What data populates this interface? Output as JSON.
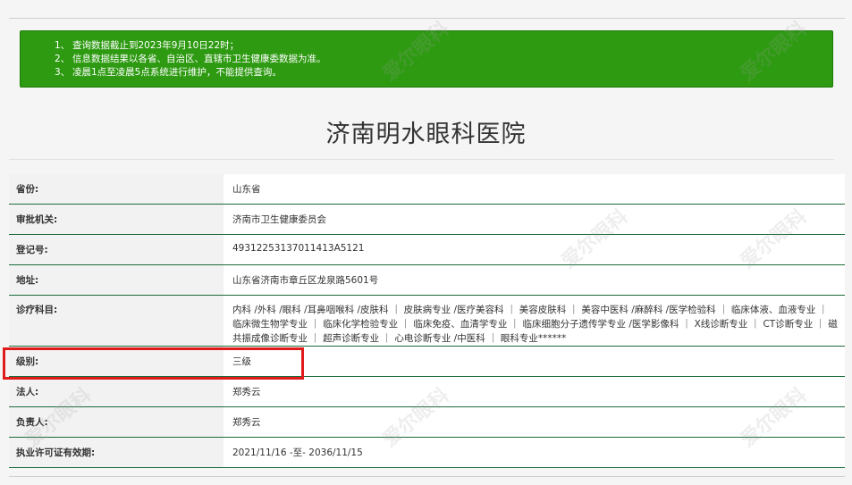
{
  "notice": {
    "items": [
      {
        "num": "1、",
        "text": "查询数据截止到2023年9月10日22时；"
      },
      {
        "num": "2、",
        "text": "信息数据结果以各省、自治区、直辖市卫生健康委数据为准。"
      },
      {
        "num": "3、",
        "text": "凌晨1点至凌晨5点系统进行维护，不能提供查询。"
      }
    ],
    "bg_color": "#2e9a12"
  },
  "hospital_name": "济南明水眼科医院",
  "rows": [
    {
      "key": "省份:",
      "value": "山东省"
    },
    {
      "key": "审批机关:",
      "value": "济南市卫生健康委员会"
    },
    {
      "key": "登记号:",
      "value": "49312253137011413A5121"
    },
    {
      "key": "地址:",
      "value": "山东省济南市章丘区龙泉路5601号"
    },
    {
      "key": "诊疗科目:",
      "value": "内科 /外科 /眼科 /耳鼻咽喉科 /皮肤科 ｜ 皮肤病专业 /医疗美容科 ｜ 美容皮肤科 ｜ 美容中医科 /麻醉科 /医学检验科 ｜ 临床体液、血液专业 ｜ 临床微生物学专业 ｜ 临床化学检验专业 ｜ 临床免疫、血清学专业 ｜ 临床细胞分子遗传学专业 /医学影像科 ｜ X线诊断专业 ｜ CT诊断专业 ｜ 磁共振成像诊断专业 ｜ 超声诊断专业 ｜ 心电诊断专业 /中医科 ｜ 眼科专业******"
    },
    {
      "key": "级别:",
      "value": "三级"
    },
    {
      "key": "法人:",
      "value": "郑秀云"
    },
    {
      "key": "负责人:",
      "value": "郑秀云"
    },
    {
      "key": "执业许可证有效期:",
      "value": "2021/11/16 -至- 2036/11/15"
    }
  ],
  "watermark": "爱尔眼科",
  "highlight_color": "#e01b1b"
}
